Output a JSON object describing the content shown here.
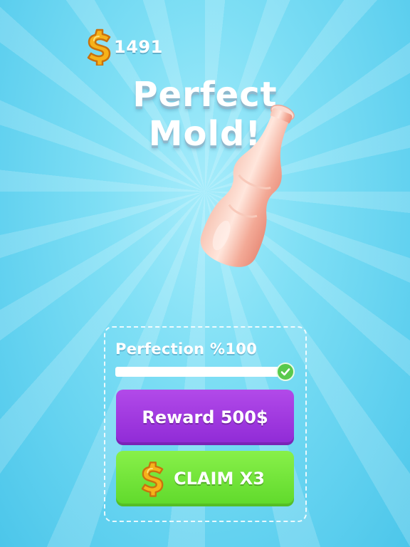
{
  "hud": {
    "coin_icon": "dollar-coin-icon",
    "coin_count": "1491"
  },
  "title": {
    "line1": "Perfect",
    "line2": "Mold!"
  },
  "result_panel": {
    "perfection_label": "Perfection %100",
    "perfection_progress": 1.0,
    "complete_icon": "check-icon",
    "reward_button": "Reward 500$",
    "claim_button": "CLAIM X3",
    "claim_icon": "dollar-coin-icon"
  },
  "colors": {
    "background": "#6fd8f2",
    "reward_button": "#9b35dd",
    "claim_button": "#72e53a",
    "coin": "#f6b21a",
    "check": "#59c94c"
  }
}
